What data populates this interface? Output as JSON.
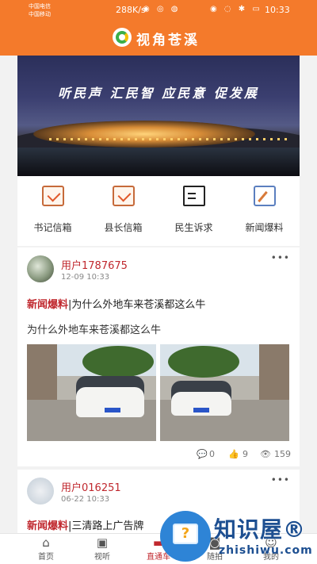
{
  "status_bar": {
    "carrier_1": "中国电信",
    "carrier_2": "中国移动",
    "speed": "288K/s",
    "time": "10:33"
  },
  "header": {
    "title": "视角苍溪",
    "brand_color": "#f47a2b"
  },
  "banner": {
    "slogan": "听民声 汇民智 应民意 促发展"
  },
  "quick_links": [
    {
      "label": "书记信箱",
      "icon": "envelope-icon"
    },
    {
      "label": "县长信箱",
      "icon": "envelope-icon"
    },
    {
      "label": "民生诉求",
      "icon": "document-edit-icon"
    },
    {
      "label": "新闻爆料",
      "icon": "pen-icon"
    }
  ],
  "posts": [
    {
      "user": "用户1787675",
      "date": "12-09 10:33",
      "tag": "新闻爆料",
      "title": "为什么外地车来苍溪都这么牛",
      "desc": "为什么外地车来苍溪都这么牛",
      "comments": "0",
      "likes": "9",
      "views": "159"
    },
    {
      "user": "用户016251",
      "date": "06-22 10:33",
      "tag": "新闻爆料",
      "title": "三清路上广告牌"
    }
  ],
  "tabbar": [
    {
      "label": "首页",
      "icon": "home-icon"
    },
    {
      "label": "视听",
      "icon": "tv-icon"
    },
    {
      "label": "直通车",
      "icon": "bus-icon"
    },
    {
      "label": "随拍",
      "icon": "camera-icon"
    },
    {
      "label": "我的",
      "icon": "user-icon"
    }
  ],
  "watermark": {
    "text": "知识屋®",
    "sub": "zhishiwu.com"
  }
}
